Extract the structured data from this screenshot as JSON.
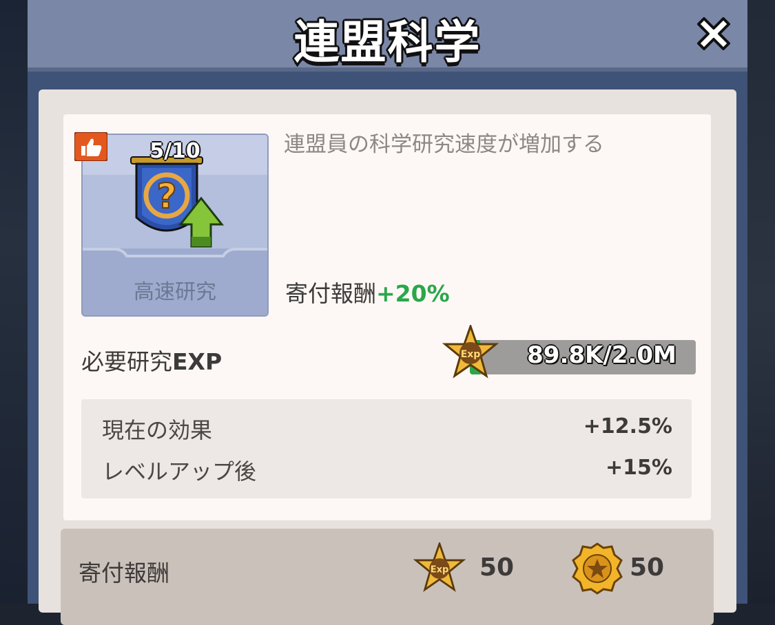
{
  "dialog": {
    "title": "連盟科学"
  },
  "research": {
    "name": "高速研究",
    "level": "5/10",
    "description": "連盟員の科学研究速度が増加する",
    "donation_bonus_label": "寄付報酬",
    "donation_bonus_value": "+20%",
    "required_label": "必要研究",
    "required_label_suffix": "EXP",
    "exp_progress": "89.8K/2.0M",
    "exp_fill_fraction": 0.045
  },
  "effects": {
    "current_label": "現在の効果",
    "current_value": "+12.5%",
    "next_label": "レベルアップ後",
    "next_value": "+15%"
  },
  "rewards": {
    "label": "寄付報酬",
    "exp_amount": "50",
    "coin_amount": "50"
  },
  "colors": {
    "accent_green": "#2aa74a",
    "title_bar": "#7a87a7",
    "dialog_frame": "#3f5277"
  },
  "icons": [
    "close-icon",
    "thumbs-up-icon",
    "research-banner-icon",
    "exp-star-icon",
    "alliance-coin-icon"
  ]
}
